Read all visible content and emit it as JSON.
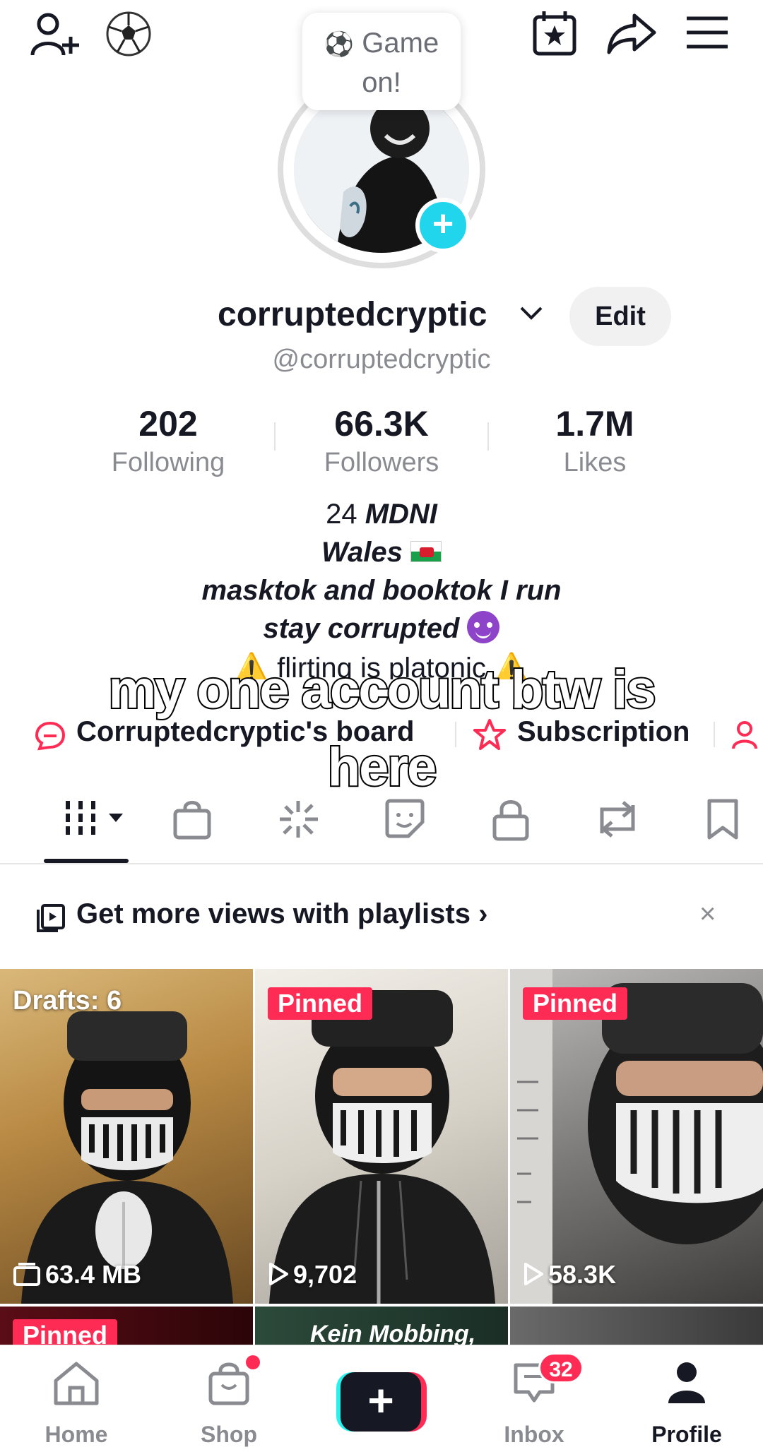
{
  "header": {
    "tooltip_emoji": "⚽",
    "tooltip_line1": "Game",
    "tooltip_line2": "on!"
  },
  "profile": {
    "username": "corruptedcryptic",
    "handle": "@corruptedcryptic",
    "edit_label": "Edit",
    "stats": [
      {
        "value": "202",
        "label": "Following"
      },
      {
        "value": "66.3K",
        "label": "Followers"
      },
      {
        "value": "1.7M",
        "label": "Likes"
      }
    ],
    "bio": {
      "line1_plain": "24 ",
      "line1_bold": "MDNI",
      "line2": "Wales ",
      "line3": "masktok and booktok I run",
      "line4": "stay corrupted ",
      "line5": "⚠️ flirting is platonic ⚠️"
    },
    "links": {
      "board": "Corruptedcryptic's board",
      "subscription": "Subscription"
    }
  },
  "caption": {
    "line1": "my one account btw is",
    "line2": "here"
  },
  "banner": {
    "text": "Get more views with playlists ›",
    "close": "×"
  },
  "grid": {
    "tiles": [
      {
        "badge": "Drafts: 6",
        "stat": "63.4 MB",
        "stat_icon": "folder-icon"
      },
      {
        "badge": "Pinned",
        "stat": "9,702",
        "stat_icon": "play-icon"
      },
      {
        "badge": "Pinned",
        "stat": "58.3K",
        "stat_icon": "play-icon"
      },
      {
        "badge": "Pinned"
      },
      {
        "overlay_text": "Kein Mobbing,"
      },
      {}
    ]
  },
  "nav": {
    "home": "Home",
    "shop": "Shop",
    "create": "+",
    "inbox": "Inbox",
    "inbox_count": "32",
    "profile": "Profile"
  },
  "colors": {
    "accent": "#fe2c55",
    "cyan": "#20d5ec",
    "text": "#161823",
    "muted": "#8a8b91"
  }
}
